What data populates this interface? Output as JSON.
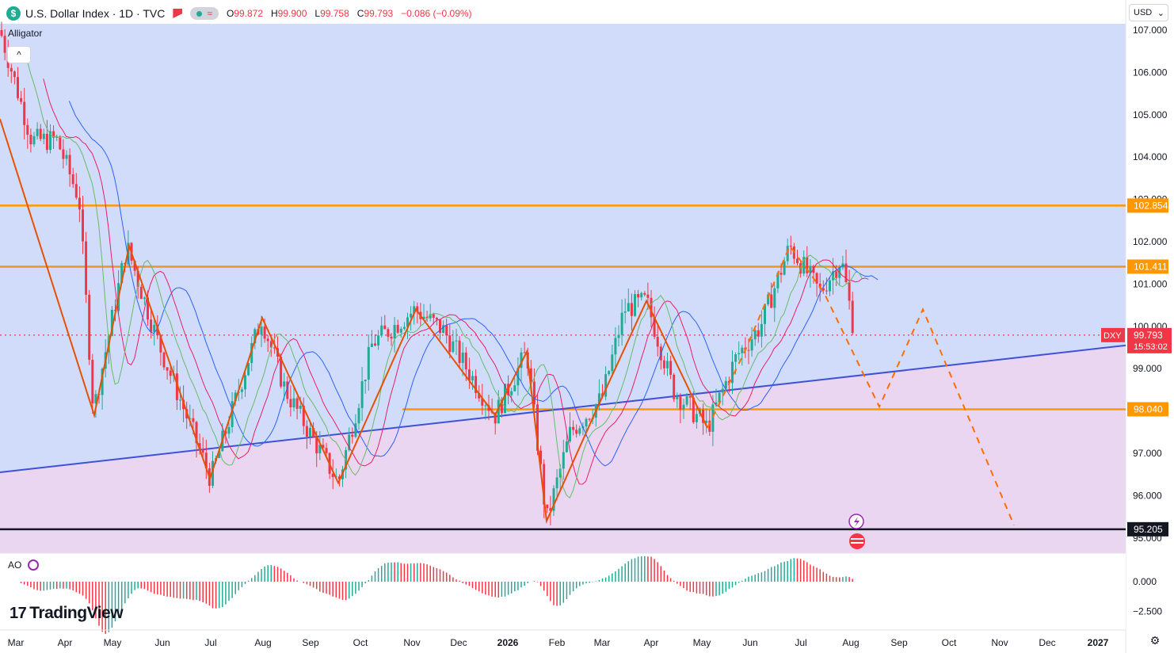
{
  "header": {
    "symbol_icon": "$",
    "title": "U.S. Dollar Index · 1D · TVC",
    "alert_icon": "flag-icon",
    "pill_symbol": "≈",
    "ohlc": {
      "o_label": "O",
      "o": "99.872",
      "h_label": "H",
      "h": "99.900",
      "l_label": "L",
      "l": "99.758",
      "c_label": "C",
      "c": "99.793",
      "change": "−0.086 (−0.09%)"
    }
  },
  "indicator_name": "Alligator",
  "collapse_icon": "^",
  "currency_selector": "USD",
  "ao_label": "AO",
  "logo_text": "TradingView",
  "logo_mark": "17",
  "settings_icon": "gear-icon",
  "colors": {
    "bull": "#22ab94",
    "bear": "#f23645",
    "level": "#ff9800",
    "pattern": "#e65100",
    "trend": "#3f51d6",
    "upper_bg": "#d1dcfb",
    "lower_bg": "#ead6f0",
    "jaw": "#2962ff",
    "teeth": "#e91e63",
    "lips": "#66bb6a"
  },
  "chart_data": {
    "type": "candlestick",
    "title": "U.S. Dollar Index · 1D · TVC",
    "x_ticks": [
      "Mar",
      "Apr",
      "May",
      "Jun",
      "Jul",
      "Aug",
      "Sep",
      "Oct",
      "Nov",
      "Dec",
      "2026",
      "Feb",
      "Mar",
      "Apr",
      "May",
      "Jun",
      "Jul",
      "Aug",
      "Sep",
      "Oct",
      "Nov",
      "Dec",
      "2027"
    ],
    "y_ticks": [
      "107.000",
      "106.000",
      "105.000",
      "104.000",
      "103.000",
      "102.000",
      "101.000",
      "100.000",
      "99.000",
      "98.000",
      "97.000",
      "96.000",
      "95.000"
    ],
    "ylim": [
      94.6,
      107.1
    ],
    "price_labels": [
      {
        "label": "102.854",
        "value": 102.854,
        "color": "#ff9800"
      },
      {
        "label": "101.411",
        "value": 101.411,
        "color": "#ff9800"
      },
      {
        "label": "98.040",
        "value": 98.04,
        "color": "#ff9800"
      },
      {
        "label": "95.205",
        "value": 95.205,
        "color": "#131722"
      }
    ],
    "current": {
      "symbol": "DXY",
      "price": "99.793",
      "countdown": "15:53:02",
      "value": 99.793
    },
    "swing_points": [
      {
        "date": "Feb",
        "value": 107.2
      },
      {
        "date": "Apr",
        "value": 97.9
      },
      {
        "date": "May",
        "value": 101.9
      },
      {
        "date": "Jul",
        "value": 96.4
      },
      {
        "date": "Aug",
        "value": 100.2
      },
      {
        "date": "Sep",
        "value": 96.3
      },
      {
        "date": "Nov",
        "value": 100.4
      },
      {
        "date": "Dec",
        "value": 97.9
      },
      {
        "date": "Jan 2026",
        "value": 99.4
      },
      {
        "date": "Feb 2026",
        "value": 95.4
      },
      {
        "date": "Apr 2026",
        "value": 100.6
      },
      {
        "date": "May 2026",
        "value": 97.6
      },
      {
        "date": "Jun 2026",
        "value": 101.9
      },
      {
        "date": "Aug 2026",
        "value": 99.3
      },
      {
        "date": "Aug 2026",
        "value": 98.1
      },
      {
        "date": "Sep 2026",
        "value": 100.4
      },
      {
        "date": "Nov 2026",
        "value": 95.3
      }
    ],
    "ao_ticks": [
      "0.000",
      "−2.500"
    ],
    "ao_ylim": [
      -3.6,
      2.4
    ]
  }
}
